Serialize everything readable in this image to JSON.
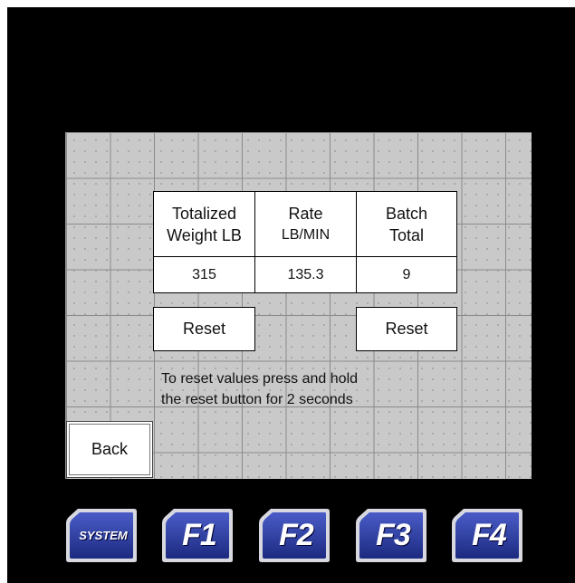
{
  "table": {
    "headers": [
      {
        "line1": "Totalized",
        "line2": "Weight  LB"
      },
      {
        "line1": "Rate",
        "line2": "LB/MIN"
      },
      {
        "line1": "Batch",
        "line2": "Total"
      }
    ],
    "values": [
      "315",
      "135.3",
      "9"
    ]
  },
  "buttons": {
    "reset_totalized": "Reset",
    "reset_batch": "Reset",
    "back": "Back"
  },
  "instructions": {
    "line1": "To reset values press and hold",
    "line2": "the reset button for 2 seconds"
  },
  "function_keys": [
    "SYSTEM",
    "F1",
    "F2",
    "F3",
    "F4"
  ],
  "colors": {
    "bezel": "#000000",
    "screen": "#c9c9c9",
    "key_face": "#2a3a9a"
  }
}
